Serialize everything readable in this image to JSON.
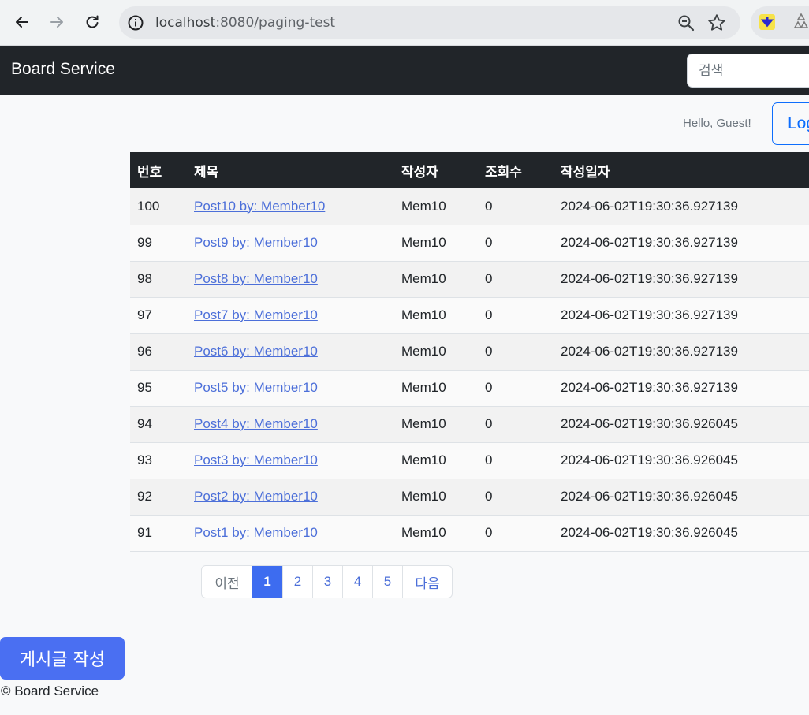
{
  "browser": {
    "url_host": "localhost",
    "url_rest": ":8080/paging-test"
  },
  "navbar": {
    "brand": "Board Service",
    "search_placeholder": "검색"
  },
  "user": {
    "greeting": "Hello, Guest!",
    "login_label": "Login"
  },
  "table": {
    "headers": [
      "번호",
      "제목",
      "작성자",
      "조회수",
      "작성일자"
    ],
    "rows": [
      {
        "no": "100",
        "title": "Post10 by: Member10",
        "author": "Mem10",
        "views": "0",
        "date": "2024-06-02T19:30:36.927139"
      },
      {
        "no": "99",
        "title": "Post9 by: Member10",
        "author": "Mem10",
        "views": "0",
        "date": "2024-06-02T19:30:36.927139"
      },
      {
        "no": "98",
        "title": "Post8 by: Member10",
        "author": "Mem10",
        "views": "0",
        "date": "2024-06-02T19:30:36.927139"
      },
      {
        "no": "97",
        "title": "Post7 by: Member10",
        "author": "Mem10",
        "views": "0",
        "date": "2024-06-02T19:30:36.927139"
      },
      {
        "no": "96",
        "title": "Post6 by: Member10",
        "author": "Mem10",
        "views": "0",
        "date": "2024-06-02T19:30:36.927139"
      },
      {
        "no": "95",
        "title": "Post5 by: Member10",
        "author": "Mem10",
        "views": "0",
        "date": "2024-06-02T19:30:36.927139"
      },
      {
        "no": "94",
        "title": "Post4 by: Member10",
        "author": "Mem10",
        "views": "0",
        "date": "2024-06-02T19:30:36.926045"
      },
      {
        "no": "93",
        "title": "Post3 by: Member10",
        "author": "Mem10",
        "views": "0",
        "date": "2024-06-02T19:30:36.926045"
      },
      {
        "no": "92",
        "title": "Post2 by: Member10",
        "author": "Mem10",
        "views": "0",
        "date": "2024-06-02T19:30:36.926045"
      },
      {
        "no": "91",
        "title": "Post1 by: Member10",
        "author": "Mem10",
        "views": "0",
        "date": "2024-06-02T19:30:36.926045"
      }
    ]
  },
  "pagination": {
    "prev_label": "이전",
    "pages": [
      "1",
      "2",
      "3",
      "4",
      "5"
    ],
    "active_page": "1",
    "next_label": "다음"
  },
  "write_button": "게시글 작성",
  "footer": "© Board Service",
  "colors": {
    "navbar_bg": "#212529",
    "primary": "#0d6efd",
    "link": "#4c6fd9",
    "active_page": "#3d6cf0",
    "write_button": "#4a6ff2"
  }
}
